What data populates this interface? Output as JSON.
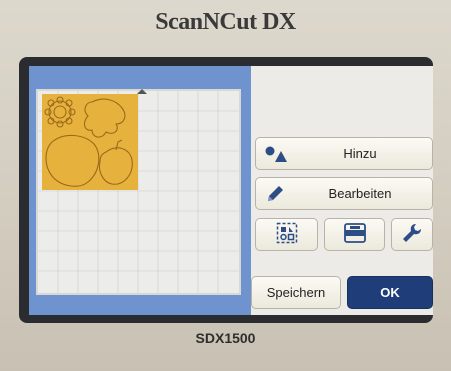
{
  "device": {
    "brand": "ScanNCut DX",
    "model": "SDX1500"
  },
  "buttons": {
    "add_label": "Hinzu",
    "edit_label": "Bearbeiten",
    "save_label": "Speichern",
    "ok_label": "OK"
  },
  "icons": {
    "add": "shapes-icon",
    "edit": "pencil-icon",
    "layout": "layout-icon",
    "mat": "mat-icon",
    "settings": "wrench-icon"
  },
  "colors": {
    "preview_background": "#6e93cf",
    "design_fill": "#e6b23d",
    "ok_button": "#1f3d78",
    "icon_accent": "#2d4d86"
  }
}
